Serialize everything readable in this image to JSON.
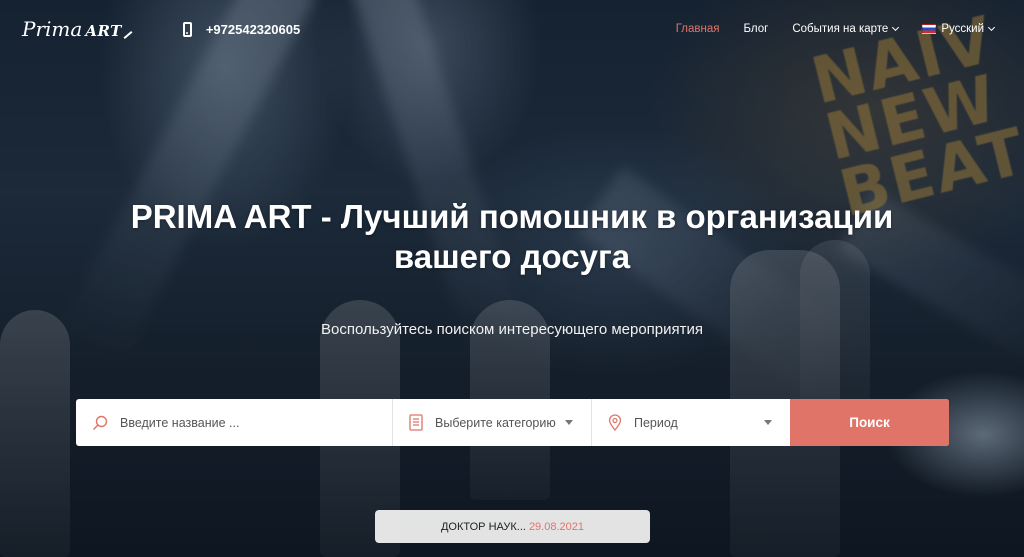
{
  "header": {
    "logo_text_script": "Prima",
    "logo_text_caps": "ART",
    "phone": "+972542320605",
    "nav": [
      {
        "label": "Главная",
        "active": true
      },
      {
        "label": "Блог",
        "active": false
      },
      {
        "label": "События на карте",
        "active": false,
        "has_dropdown": true
      },
      {
        "label": "Русский",
        "active": false,
        "has_dropdown": true,
        "flag": "ru-flag-icon"
      }
    ]
  },
  "hero": {
    "title_line1": "PRIMA ART - Лучший помошник в организации",
    "title_line2": "вашего досуга",
    "subtitle": "Воспользуйтесь поиском интересующего мероприятия",
    "background_sign": [
      "NAIV",
      "NEW",
      "BEAT"
    ]
  },
  "search": {
    "name_placeholder": "Введите название ...",
    "category_label": "Выберите категорию",
    "period_label": "Период",
    "button_label": "Поиск"
  },
  "event": {
    "title": "ДОКТОР НАУК...",
    "date": "29.08.2021"
  },
  "colors": {
    "accent": "#e07468",
    "nav_active": "#e0756a"
  }
}
